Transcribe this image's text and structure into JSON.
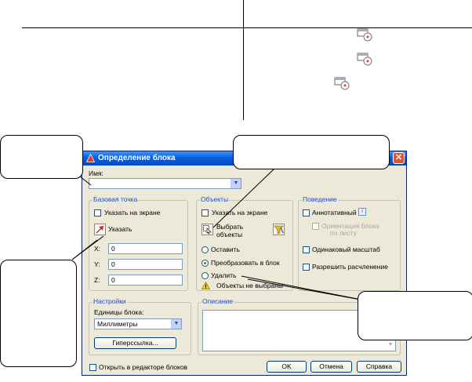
{
  "dialog": {
    "title": "Определение блока",
    "name_label": "Имя:",
    "name_value": "",
    "base_point": {
      "title": "Базовая точка",
      "specify_on_screen": "Указать на экране",
      "pick_label": "Указать",
      "x_label": "X:",
      "x_value": "0",
      "y_label": "Y:",
      "y_value": "0",
      "z_label": "Z:",
      "z_value": "0"
    },
    "objects": {
      "title": "Объекты",
      "specify_on_screen": "Указать на экране",
      "select_label_1": "Выбрать",
      "select_label_2": "объекты",
      "retain": "Оставить",
      "convert": "Преобразовать в блок",
      "delete": "Удалить",
      "status": "Объекты не выбраны"
    },
    "behavior": {
      "title": "Поведение",
      "annotative": "Аннотативный",
      "orient_1": "Ориентация блока",
      "orient_2": "по листу",
      "uniform_scale": "Одинаковый масштаб",
      "allow_explode": "Разрешить расчленение"
    },
    "settings": {
      "title": "Настройки",
      "units_label": "Единицы блока:",
      "units_value": "Миллиметры",
      "hyperlink": "Гиперссылка..."
    },
    "description": {
      "title": "Описание"
    },
    "open_in_editor": "Открыть в редакторе блоков",
    "ok": "OK",
    "cancel": "Отмена",
    "help": "Справка"
  }
}
